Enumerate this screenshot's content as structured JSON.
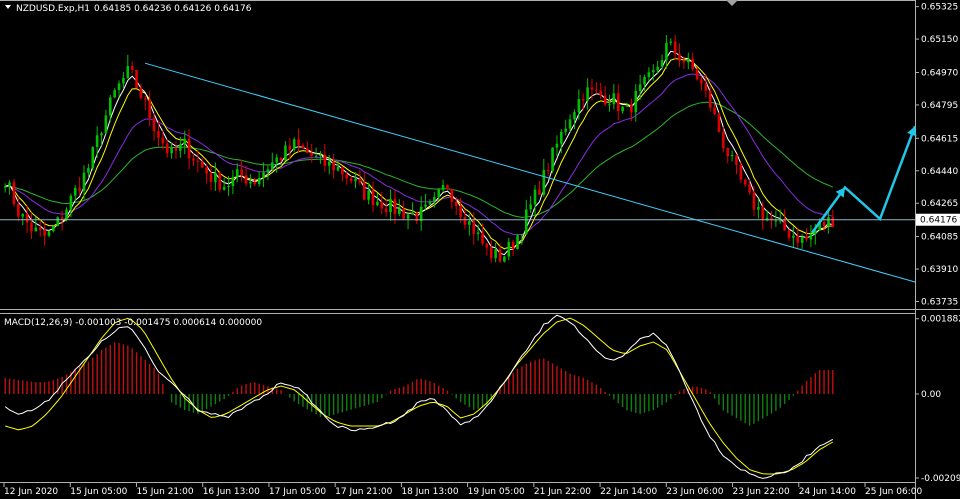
{
  "chart_data": [
    {
      "type": "candlestick",
      "title": "NZDUSD.Exp,H1",
      "ohlc_text": "0.64185 0.64236 0.64126 0.64176",
      "ylim": [
        0.637,
        0.6535
      ],
      "y_ticks": [
        "0.65325",
        "0.65150",
        "0.64970",
        "0.64795",
        "0.64615",
        "0.64440",
        "0.64265",
        "0.64085",
        "0.63910",
        "0.63735"
      ],
      "current_price": "0.64176",
      "x_ticks": [
        "12 Jun 2020",
        "15 Jun 05:00",
        "15 Jun 21:00",
        "16 Jun 13:00",
        "17 Jun 05:00",
        "17 Jun 21:00",
        "18 Jun 13:00",
        "19 Jun 05:00",
        "21 Jun 22:00",
        "22 Jun 14:00",
        "23 Jun 06:00",
        "23 Jun 22:00",
        "24 Jun 14:00",
        "25 Jun 06:00"
      ],
      "close_path": [
        0.644,
        0.6421,
        0.6412,
        0.6408,
        0.6418,
        0.6432,
        0.6445,
        0.6468,
        0.6487,
        0.6498,
        0.6482,
        0.6465,
        0.6452,
        0.6458,
        0.6448,
        0.644,
        0.6436,
        0.6442,
        0.6438,
        0.6446,
        0.6452,
        0.6458,
        0.6453,
        0.6448,
        0.6446,
        0.644,
        0.6432,
        0.6428,
        0.6424,
        0.6421,
        0.642,
        0.6425,
        0.6437,
        0.6423,
        0.6412,
        0.64,
        0.6397,
        0.6407,
        0.6423,
        0.644,
        0.6458,
        0.6475,
        0.6487,
        0.6485,
        0.6483,
        0.6475,
        0.6487,
        0.6496,
        0.6512,
        0.6505,
        0.6497,
        0.6482,
        0.646,
        0.6443,
        0.6428,
        0.642,
        0.6414,
        0.641,
        0.6406,
        0.6414,
        0.6418
      ],
      "macd": {
        "label": "MACD(12,26,9) -0.001003 -0.001475 0.000614 0.000000",
        "ylim": [
          -0.00215,
          0.00195
        ],
        "y_ticks": [
          "0.001882",
          "0.00",
          "-0.002099"
        ],
        "hist": [
          0.0004,
          0.00035,
          0.0003,
          0.0003,
          0.0004,
          0.0006,
          0.0008,
          0.0011,
          0.0013,
          0.0012,
          0.0009,
          0.0006,
          -0.0002,
          -0.0004,
          -0.0005,
          -0.0003,
          -0.0001,
          0.0002,
          0.0003,
          0.0002,
          0.0001,
          -0.0002,
          -0.0004,
          -0.0006,
          -0.0005,
          -0.0004,
          -0.0003,
          -0.0002,
          0.0001,
          0.0002,
          0.0004,
          0.0003,
          0.0001,
          -0.0002,
          -0.0004,
          -0.0003,
          0.0002,
          0.0006,
          0.0008,
          0.0009,
          0.0007,
          0.0005,
          0.0004,
          0.0002,
          -0.0001,
          -0.0004,
          -0.0005,
          -0.0004,
          -0.0002,
          0.0001,
          0.0002,
          0.0001,
          -0.0004,
          -0.0006,
          -0.0008,
          -0.0006,
          -0.0004,
          -0.0001,
          0.0003,
          0.0006,
          0.0006
        ],
        "macd_line": [
          -0.0003,
          -0.0005,
          -0.0004,
          -0.0002,
          0.0002,
          0.0006,
          0.0009,
          0.0013,
          0.0016,
          0.0017,
          0.0012,
          0.0006,
          0.0003,
          0.0,
          -0.0004,
          -0.0005,
          -0.0006,
          -0.0004,
          -0.0002,
          0.0,
          0.0003,
          0.0002,
          -0.0001,
          -0.0005,
          -0.0008,
          -0.0009,
          -0.0009,
          -0.0008,
          -0.0007,
          -0.0005,
          -0.0002,
          -0.0001,
          -0.0004,
          -0.0008,
          -0.0006,
          -0.0003,
          0.0002,
          0.0007,
          0.0012,
          0.0017,
          0.002,
          0.0018,
          0.0014,
          0.001,
          0.0008,
          0.001,
          0.0014,
          0.0015,
          0.0012,
          0.0005,
          -0.0003,
          -0.001,
          -0.0015,
          -0.0018,
          -0.002,
          -0.0021,
          -0.002,
          -0.0019,
          -0.0016,
          -0.0013,
          -0.0011
        ],
        "signal_line": [
          -0.0008,
          -0.0009,
          -0.0008,
          -0.0005,
          -0.0001,
          0.0004,
          0.0009,
          0.0014,
          0.0018,
          0.0019,
          0.0016,
          0.001,
          0.0004,
          -0.0001,
          -0.0004,
          -0.0006,
          -0.0005,
          -0.0003,
          -0.0001,
          0.0001,
          0.0002,
          0.0001,
          -0.0002,
          -0.0005,
          -0.0007,
          -0.0008,
          -0.0008,
          -0.0008,
          -0.0007,
          -0.0005,
          -0.0003,
          -0.0002,
          -0.0003,
          -0.0006,
          -0.0005,
          -0.0002,
          0.0002,
          0.0007,
          0.0011,
          0.0015,
          0.0018,
          0.0019,
          0.0017,
          0.0014,
          0.0011,
          0.001,
          0.0012,
          0.0013,
          0.0011,
          0.0005,
          -0.0001,
          -0.0007,
          -0.0012,
          -0.0016,
          -0.0019,
          -0.002,
          -0.002,
          -0.0019,
          -0.0017,
          -0.0014,
          -0.0012
        ]
      },
      "colors": {
        "up": "#00c000",
        "down": "#e00000",
        "fast_ma": "#ffffff",
        "mid_ma": "#ffff00",
        "slow_ma": "#8a2be2",
        "trend_ma": "#2cb42c",
        "trendline": "#40d0ff",
        "forecast": "#20c8e8",
        "price_line": "#8fb8c8",
        "hist_up": "#c01010",
        "hist_down": "#108010"
      }
    }
  ]
}
